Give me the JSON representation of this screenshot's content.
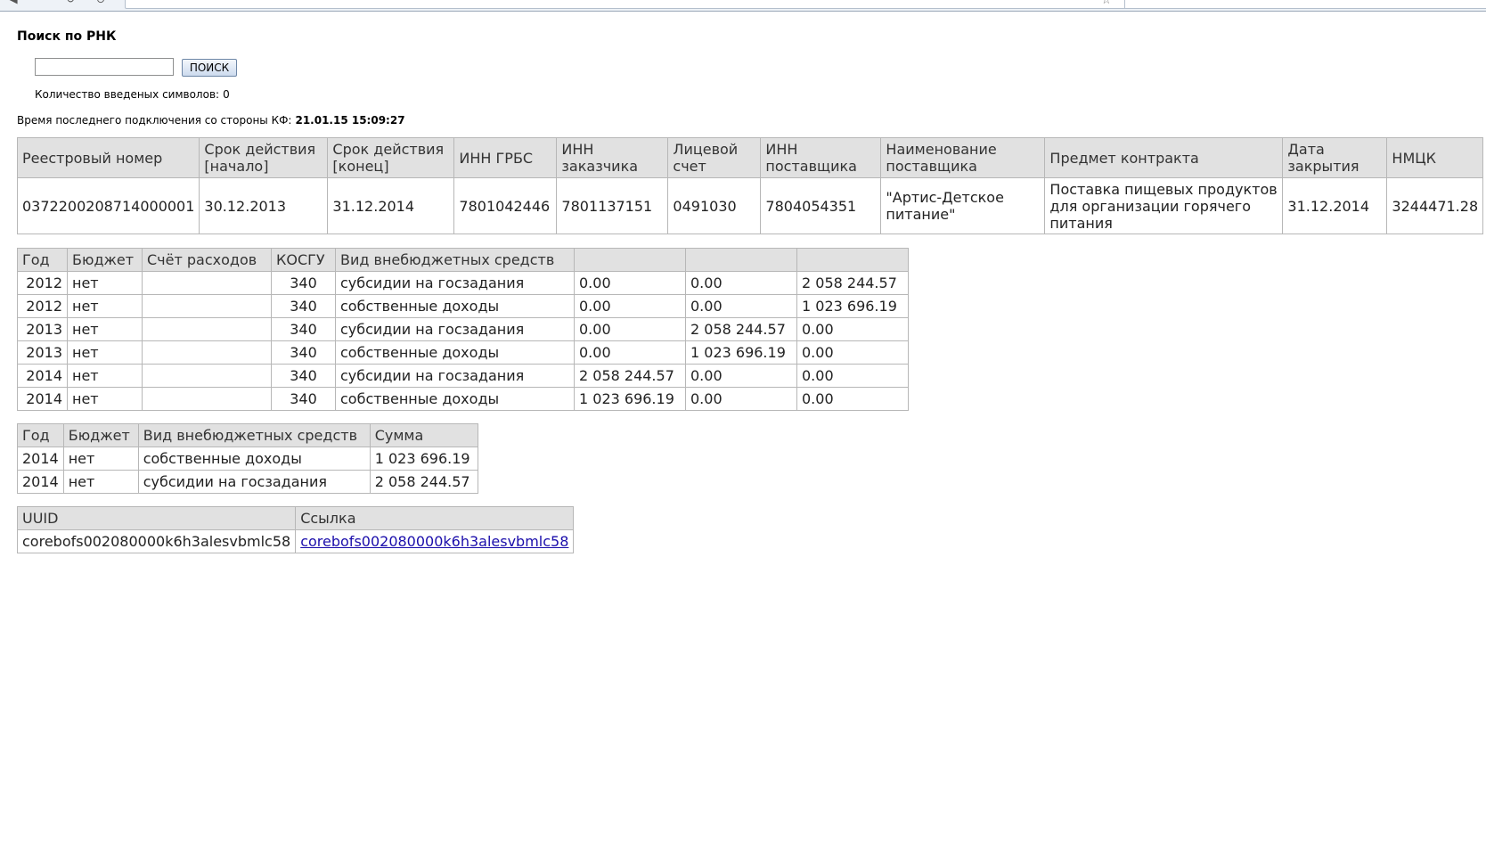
{
  "search": {
    "title": "Поиск по РНК",
    "input_value": "",
    "button_label": "ПОИСК",
    "count_label": "Количество введеных символов:",
    "count_value": "0"
  },
  "last_connection": {
    "label": "Время последнего подключения со стороны КФ:",
    "value": "21.01.15 15:09:27"
  },
  "contract_table": {
    "headers": [
      "Реестровый номер",
      "Срок действия [начало]",
      "Срок действия [конец]",
      "ИНН ГРБС",
      "ИНН заказчика",
      "Лицевой счет",
      "ИНН поставщика",
      "Наименование поставщика",
      "Предмет контракта",
      "Дата закрытия",
      "НМЦК"
    ],
    "row": [
      "0372200208714000001",
      "30.12.2013",
      "31.12.2014",
      "7801042446",
      "7801137151",
      "0491030",
      "7804054351",
      "\"Артис-Детское питание\"",
      "Поставка пищевых продуктов для организации горячего питания",
      "31.12.2014",
      "3244471.28"
    ]
  },
  "funds_table": {
    "headers": [
      "Год",
      "Бюджет",
      "Счёт расходов",
      "КОСГУ",
      "Вид внебюджетных средств",
      "",
      "",
      ""
    ],
    "rows": [
      [
        "2012",
        "нет",
        "",
        "340",
        "субсидии на госзадания",
        "0.00",
        "0.00",
        "2 058 244.57"
      ],
      [
        "2012",
        "нет",
        "",
        "340",
        "собственные доходы",
        "0.00",
        "0.00",
        "1 023 696.19"
      ],
      [
        "2013",
        "нет",
        "",
        "340",
        "субсидии на госзадания",
        "0.00",
        "2 058 244.57",
        "0.00"
      ],
      [
        "2013",
        "нет",
        "",
        "340",
        "собственные доходы",
        "0.00",
        "1 023 696.19",
        "0.00"
      ],
      [
        "2014",
        "нет",
        "",
        "340",
        "субсидии на госзадания",
        "2 058 244.57",
        "0.00",
        "0.00"
      ],
      [
        "2014",
        "нет",
        "",
        "340",
        "собственные доходы",
        "1 023 696.19",
        "0.00",
        "0.00"
      ]
    ]
  },
  "sum_table": {
    "headers": [
      "Год",
      "Бюджет",
      "Вид внебюджетных средств",
      "Сумма"
    ],
    "rows": [
      [
        "2014",
        "нет",
        "собственные доходы",
        "1 023 696.19"
      ],
      [
        "2014",
        "нет",
        "субсидии на госзадания",
        "2 058 244.57"
      ]
    ]
  },
  "uuid_table": {
    "headers": [
      "UUID",
      "Ссылка"
    ],
    "uuid": "corebofs002080000k6h3alesvbmlc58",
    "link": "corebofs002080000k6h3alesvbmlc58"
  }
}
